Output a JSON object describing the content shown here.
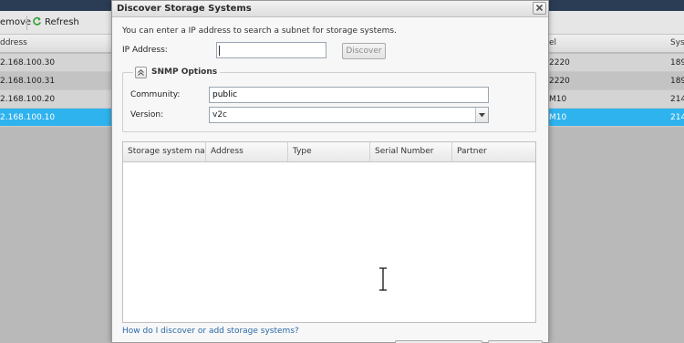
{
  "background": {
    "toolbar": {
      "remove_label": "emove",
      "refresh_label": "Refresh"
    },
    "headers": {
      "address": "ddress",
      "model": "el",
      "system": "Syst"
    },
    "rows": [
      {
        "address": "2.168.100.30",
        "model": "2220",
        "system": "189"
      },
      {
        "address": "2.168.100.31",
        "model": "2220",
        "system": "189"
      },
      {
        "address": "2.168.100.20",
        "model": "M10",
        "system": "214"
      },
      {
        "address": "2.168.100.10",
        "model": "M10",
        "system": "214"
      }
    ],
    "selected_row_index": 3,
    "colors": {
      "selection": "#2fb3ee",
      "title_bar": "#2b3d54"
    }
  },
  "dialog": {
    "title": "Discover Storage Systems",
    "intro": "You can enter a IP address to search a subnet for storage systems.",
    "ip_label": "IP Address:",
    "ip_value": "",
    "discover_label": "Discover",
    "snmp": {
      "title": "SNMP Options",
      "community_label": "Community:",
      "community_value": "public",
      "version_label": "Version:",
      "version_value": "v2c"
    },
    "table": {
      "columns": [
        "Storage system name",
        "Address",
        "Type",
        "Serial Number",
        "Partner"
      ]
    },
    "help_link": "How do I discover or add storage systems?"
  },
  "icons": {
    "close": "close-icon",
    "refresh": "refresh-icon",
    "collapse": "chevron-up-icon",
    "dropdown": "chevron-down-icon",
    "cursor": "text-cursor-icon"
  }
}
